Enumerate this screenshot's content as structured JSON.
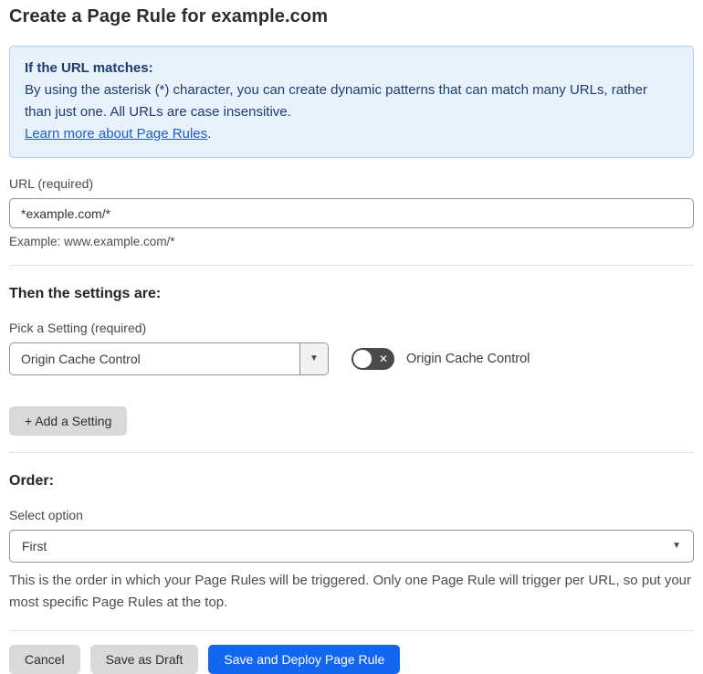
{
  "page": {
    "title": "Create a Page Rule for example.com"
  },
  "info_box": {
    "heading": "If the URL matches:",
    "body": "By using the asterisk (*) character, you can create dynamic patterns that can match many URLs, rather than just one. All URLs are case insensitive.",
    "link_label": "Learn more about Page Rules",
    "link_suffix": "."
  },
  "url_section": {
    "label": "URL (required)",
    "value": "*example.com/*",
    "helper": "Example: www.example.com/*"
  },
  "settings_section": {
    "heading": "Then the settings are:",
    "pick_label": "Pick a Setting (required)",
    "selected_setting": "Origin Cache Control",
    "toggle_state": "off",
    "toggle_label": "Origin Cache Control",
    "add_button_label": "+ Add a Setting"
  },
  "order_section": {
    "heading": "Order:",
    "label": "Select option",
    "selected_option": "First",
    "helper": "This is the order in which your Page Rules will be triggered. Only one Page Rule will trigger per URL, so put your most specific Page Rules at the top."
  },
  "footer": {
    "cancel_label": "Cancel",
    "save_draft_label": "Save as Draft",
    "save_deploy_label": "Save and Deploy Page Rule"
  },
  "icons": {
    "dropdown_caret": "▼",
    "toggle_x": "✕"
  },
  "colors": {
    "info_background": "#e8f2fc",
    "info_border": "#abcdef",
    "info_text": "#1e3c6e",
    "link_blue": "#1c5ecf",
    "primary_button_blue": "#1366f0",
    "secondary_button_gray": "#d9d9d9",
    "toggle_off_gray": "#4a4a4a"
  }
}
